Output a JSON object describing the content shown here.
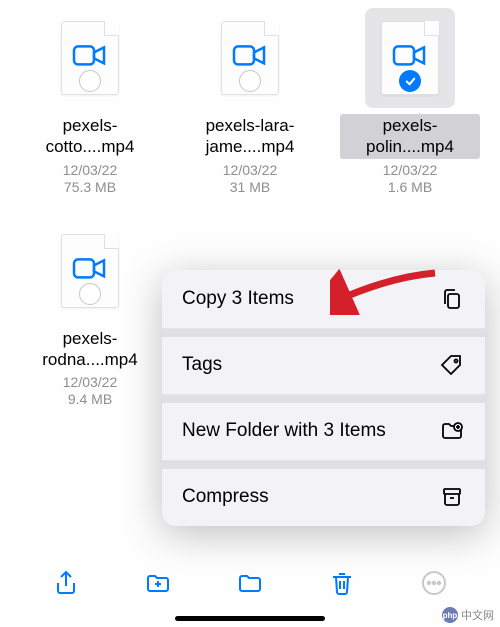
{
  "files": [
    {
      "name": "pexels-cotto....mp4",
      "date": "12/03/22",
      "size": "75.3 MB",
      "selected": false
    },
    {
      "name": "pexels-lara-jame....mp4",
      "date": "12/03/22",
      "size": "31 MB",
      "selected": false
    },
    {
      "name": "pexels-polin....mp4",
      "date": "12/03/22",
      "size": "1.6 MB",
      "selected": true
    },
    {
      "name": "pexels-rodna....mp4",
      "date": "12/03/22",
      "size": "9.4 MB",
      "selected": false
    }
  ],
  "context_menu": {
    "copy": "Copy 3 Items",
    "tags": "Tags",
    "new_folder": "New Folder with 3 Items",
    "compress": "Compress"
  },
  "toolbar": {
    "share": "share-icon",
    "new_folder": "new-folder-icon",
    "organize": "folder-icon",
    "delete": "trash-icon",
    "more": "more-icon"
  },
  "colors": {
    "accent": "#007aff",
    "red": "#d3202b",
    "gray": "#8e8e93",
    "disabled": "#c7c7cc"
  },
  "watermark": "中文网"
}
